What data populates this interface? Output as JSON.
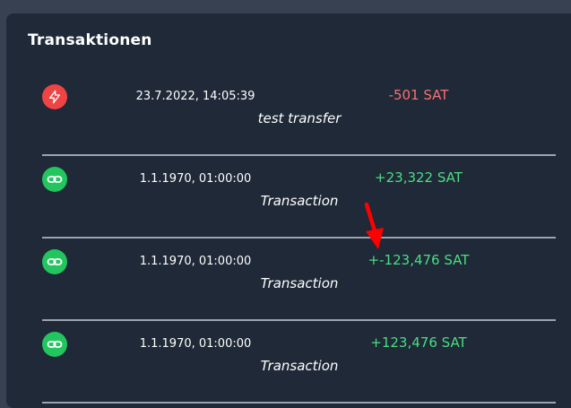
{
  "card": {
    "title": "Transaktionen"
  },
  "transactions": [
    {
      "type": "lightning",
      "icon": "lightning-icon",
      "date": "23.7.2022, 14:05:39",
      "amount": "-501 SAT",
      "direction": "negative",
      "memo": "test transfer"
    },
    {
      "type": "onchain",
      "icon": "link-icon",
      "date": "1.1.1970, 01:00:00",
      "amount": "+23,322 SAT",
      "direction": "positive",
      "memo": "Transaction"
    },
    {
      "type": "onchain",
      "icon": "link-icon",
      "date": "1.1.1970, 01:00:00",
      "amount": "+-123,476 SAT",
      "direction": "positive",
      "memo": "Transaction"
    },
    {
      "type": "onchain",
      "icon": "link-icon",
      "date": "1.1.1970, 01:00:00",
      "amount": "+123,476 SAT",
      "direction": "positive",
      "memo": "Transaction"
    }
  ],
  "colors": {
    "page_background": "#374151",
    "card_background": "#1f2937",
    "lightning_icon": "#ef4444",
    "onchain_icon": "#22c55e",
    "negative_amount": "#f87171",
    "positive_amount": "#4ade80",
    "annotation_arrow": "#ff0000"
  },
  "annotation": {
    "icon": "red-arrow-annotation"
  }
}
